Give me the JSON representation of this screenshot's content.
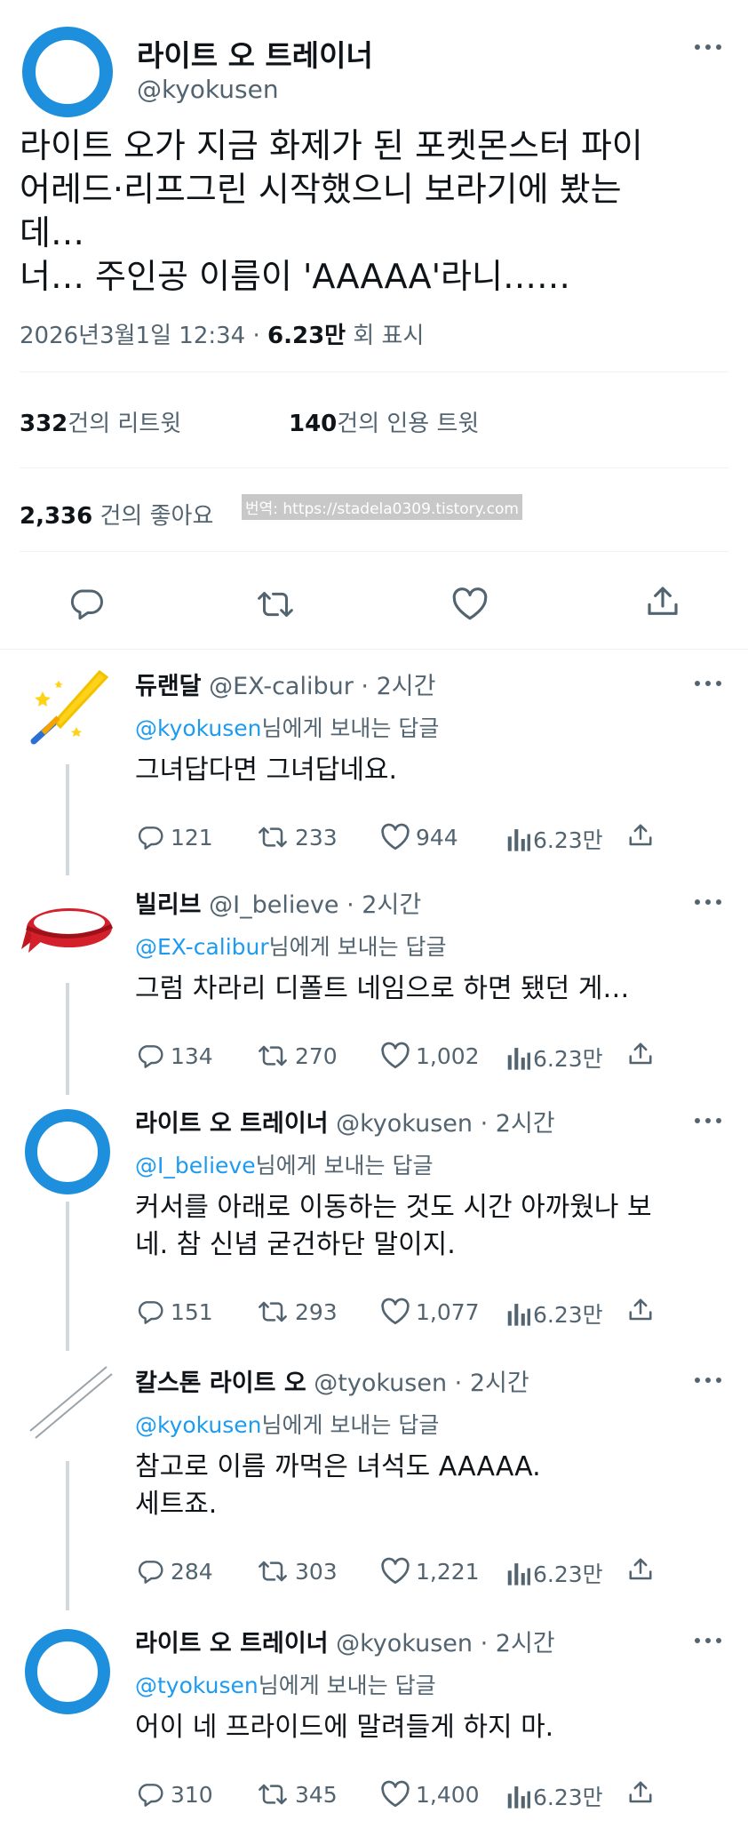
{
  "main_tweet": {
    "display_name": "라이트 오 트레이너",
    "handle": "@kyokusen",
    "text_lines": [
      "라이트 오가 지금 화제가 된 포켓몬스터 파이",
      "어레드·리프그린 시작했으니 보라기에 봤는",
      "데…",
      "너… 주인공 이름이 'AAAAA'라니……"
    ],
    "timestamp": "2026년3월1일 12:34",
    "separator": "·",
    "views_count": "6.23만",
    "views_label": "회 표시",
    "retweets_count": "332",
    "retweets_label": "건의 리트윗",
    "quotes_count": "140",
    "quotes_label": "건의 인용 트윗",
    "likes_count": "2,336",
    "likes_label": "건의 좋아요",
    "watermark": "번역: https://stadela0309.tistory.com"
  },
  "replies": [
    {
      "name": "듀랜달",
      "handle": "@EX-calibur",
      "time": "· 2시간",
      "reply_to_handle": "@kyokusen",
      "reply_to_suffix": "님에게 보내는 답글",
      "text_lines": [
        "그녀답다면 그녀답네요."
      ],
      "replies": "121",
      "retweets": "233",
      "likes": "944",
      "views": "6.23만",
      "avatar_icon": "sword-icon"
    },
    {
      "name": "빌리브",
      "handle": "@I_believe",
      "time": "· 2시간",
      "reply_to_handle": "@EX-calibur",
      "reply_to_suffix": "님에게 보내는 답글",
      "text_lines": [
        "그럼 차라리 디폴트 네임으로 하면 됐던 게…"
      ],
      "replies": "134",
      "retweets": "270",
      "likes": "1,002",
      "views": "6.23만",
      "avatar_icon": "bandana-icon"
    },
    {
      "name": "라이트 오 트레이너",
      "handle": "@kyokusen",
      "time": "· 2시간",
      "reply_to_handle": "@I_believe",
      "reply_to_suffix": "님에게 보내는 답글",
      "text_lines": [
        "커서를 아래로 이동하는 것도 시간 아까웠나 보",
        "네. 참 신념 굳건하단 말이지."
      ],
      "replies": "151",
      "retweets": "293",
      "likes": "1,077",
      "views": "6.23만",
      "avatar_icon": "ring-icon"
    },
    {
      "name": "칼스톤 라이트 오",
      "handle": "@tyokusen",
      "time": "· 2시간",
      "reply_to_handle": "@kyokusen",
      "reply_to_suffix": "님에게 보내는 답글",
      "text_lines": [
        "참고로 이름 까먹은 녀석도 AAAAA.",
        "세트죠."
      ],
      "replies": "284",
      "retweets": "303",
      "likes": "1,221",
      "views": "6.23만",
      "avatar_icon": "double-line-icon"
    },
    {
      "name": "라이트 오 트레이너",
      "handle": "@kyokusen",
      "time": "· 2시간",
      "reply_to_handle": "@tyokusen",
      "reply_to_suffix": "님에게 보내는 답글",
      "text_lines": [
        "어이 네 프라이드에 말려들게 하지 마."
      ],
      "replies": "310",
      "retweets": "345",
      "likes": "1,400",
      "views": "6.23만",
      "avatar_icon": "ring-icon"
    }
  ],
  "colors": {
    "accent": "#1d9bf0",
    "avatar_ring": "#1d8fdc",
    "muted": "#536471",
    "text": "#0f1419"
  }
}
